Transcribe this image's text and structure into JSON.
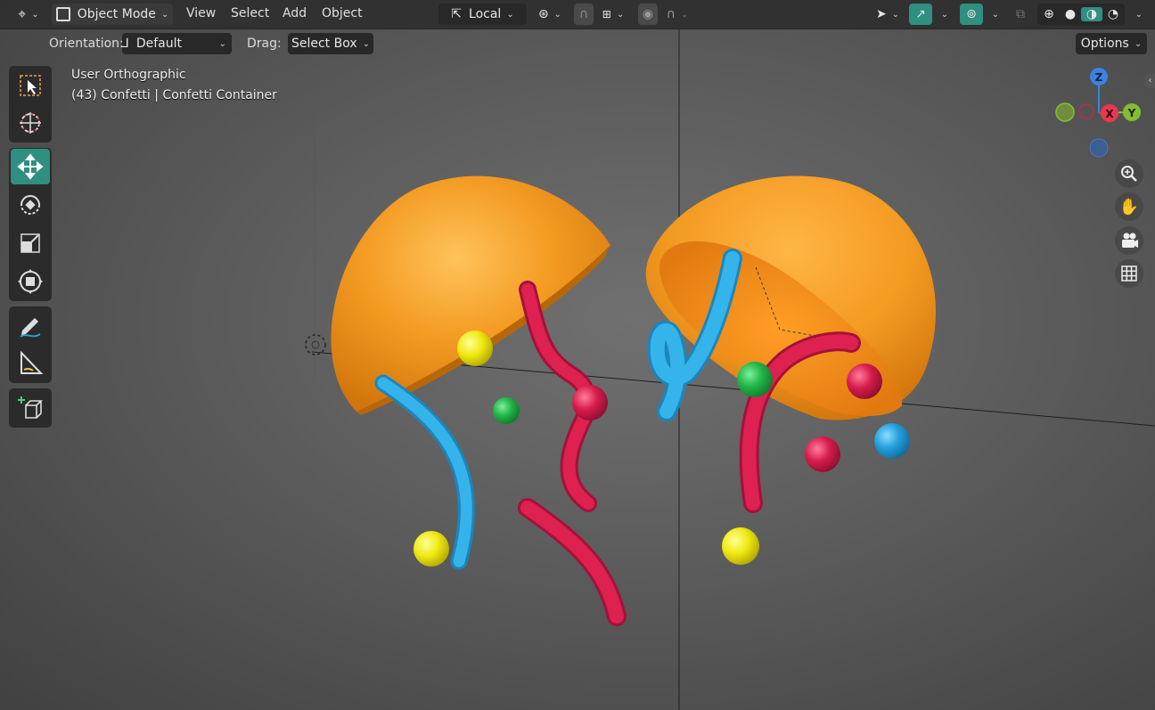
{
  "header": {
    "mode_label": "Object Mode",
    "menus": [
      "View",
      "Select",
      "Add",
      "Object"
    ],
    "transform_pivot_label": "Local",
    "options_label": "Options"
  },
  "tool_settings": {
    "orientation_label": "Orientation:",
    "orientation_value": "Default",
    "drag_label": "Drag:",
    "drag_value": "Select Box"
  },
  "viewport": {
    "view_name": "User Orthographic",
    "active_object": "(43) Confetti | Confetti Container"
  },
  "gizmo": {
    "z": "Z",
    "x": "X",
    "y": "Y"
  },
  "colors": {
    "accent": "#2f8f80",
    "orange": "#f39a21",
    "blue": "#2aa6de",
    "red": "#dc1f4f",
    "green": "#26b84a",
    "yellow": "#f2ee1a",
    "axis_x": "#e8384f",
    "axis_y": "#86bc2f",
    "axis_z": "#3b82e0"
  },
  "toolbar_tools": [
    "select-box",
    "cursor",
    "move",
    "rotate",
    "scale",
    "transform",
    "annotate",
    "measure",
    "add-cube"
  ]
}
